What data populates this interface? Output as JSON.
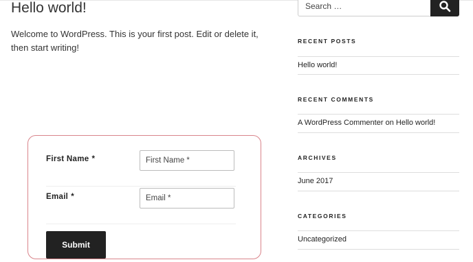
{
  "post": {
    "title": "Hello world!",
    "body": "Welcome to WordPress. This is your first post. Edit or delete it, then start writing!"
  },
  "form": {
    "first_name_label": "First Name",
    "first_name_required": "*",
    "first_name_placeholder": "First Name *",
    "email_label": "Email",
    "email_required": "*",
    "email_placeholder": "Email *",
    "submit_label": "Submit"
  },
  "sidebar": {
    "search_placeholder": "Search …",
    "recent_posts": {
      "title": "RECENT POSTS",
      "items": [
        "Hello world!"
      ]
    },
    "recent_comments": {
      "title": "RECENT COMMENTS",
      "author": "A WordPress Commenter",
      "connector": "on",
      "post": "Hello world!"
    },
    "archives": {
      "title": "ARCHIVES",
      "items": [
        "June 2017"
      ]
    },
    "categories": {
      "title": "CATEGORIES",
      "items": [
        "Uncategorized"
      ]
    }
  },
  "colors": {
    "form_border": "#d9838a",
    "button_bg": "#222222"
  }
}
